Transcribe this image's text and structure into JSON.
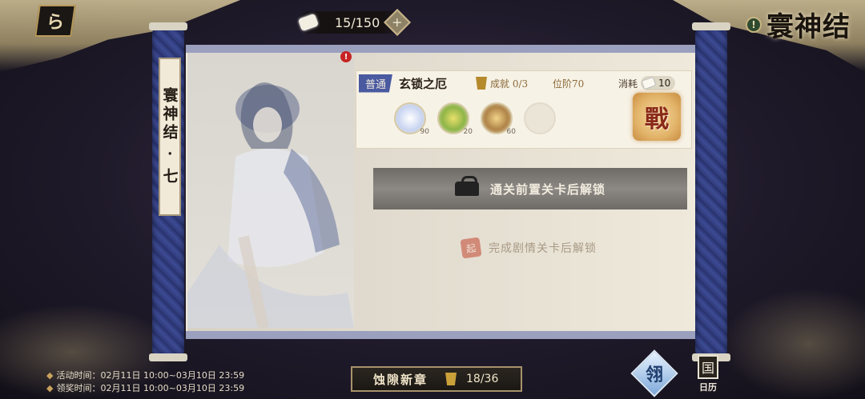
{
  "header": {
    "back_glyph": "ら",
    "resource_count": "15/150",
    "plus_glyph": "+",
    "info_glyph": "!",
    "title": "寰神结"
  },
  "scroll": {
    "label": "寰神结 · 七",
    "alert_glyph": "!"
  },
  "stage": {
    "difficulty": "普通",
    "name": "玄锁之厄",
    "achievement": "成就 0/3",
    "rank": "位阶70",
    "cost_label": "消耗",
    "cost_value": "10",
    "rewards": [
      {
        "icon": "star-crystal-icon",
        "count": "90"
      },
      {
        "icon": "gold-tripod-icon",
        "count": "20"
      },
      {
        "icon": "jade-token-icon",
        "count": "60"
      },
      {
        "icon": "empty-slot-icon",
        "count": ""
      }
    ],
    "battle_label": "戰"
  },
  "locked": {
    "prev_stage_text": "通关前置关卡后解锁",
    "story_seal": "起",
    "story_text": "完成剧情关卡后解锁"
  },
  "footer": {
    "activity_time": "活动时间：02月11日 10:00~03月10日 23:59",
    "reward_time": "领奖时间：02月11日 10:00~03月10日 23:59",
    "chapter_name": "蚀隙新章",
    "chapter_count": "18/36",
    "skill_glyph": "翎",
    "diary_glyph": "国",
    "diary_label": "日历"
  },
  "colors": {
    "roller_blue": "#2f3a78",
    "difficulty_tag": "#4a5aa0",
    "alert_red": "#c62424"
  }
}
